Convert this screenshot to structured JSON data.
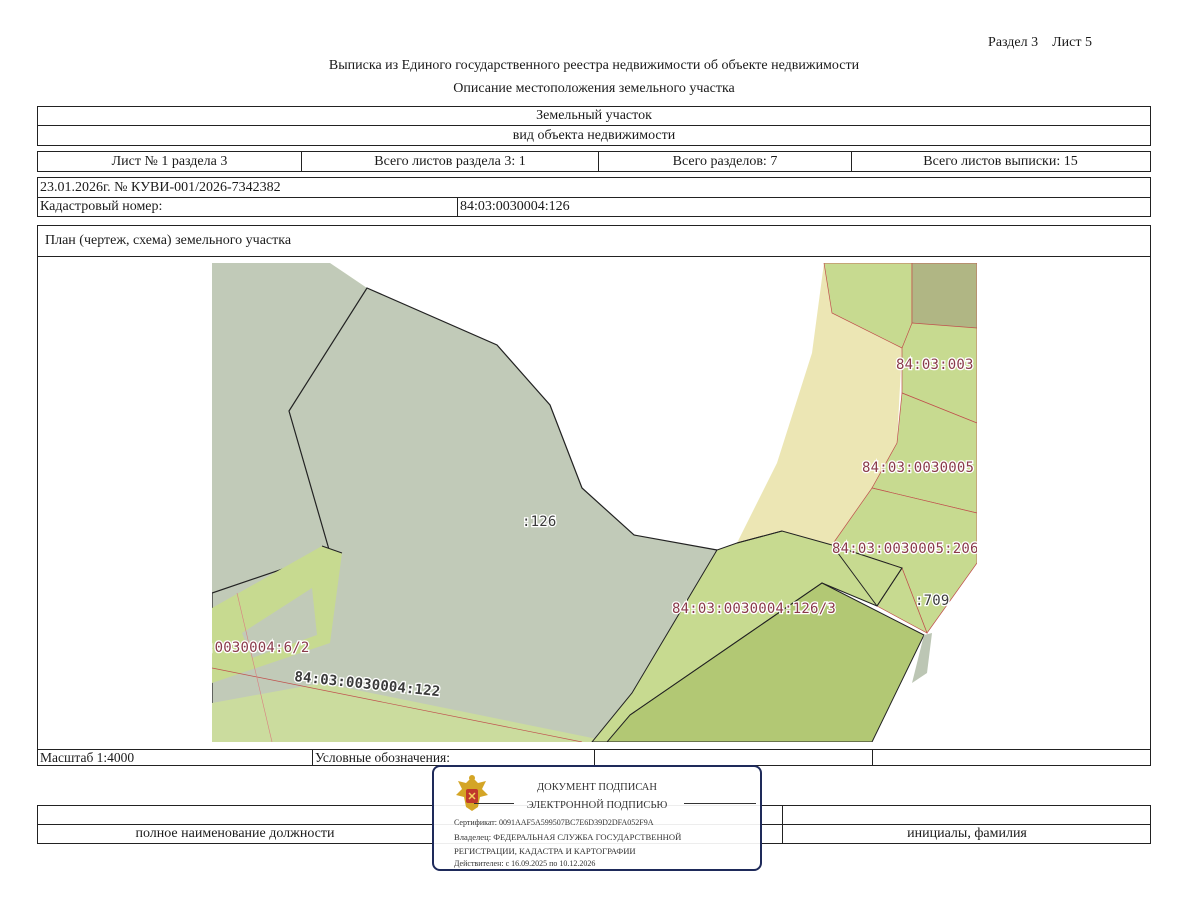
{
  "header": {
    "section_page": "Раздел 3    Лист 5",
    "title": "Выписка из Единого государственного реестра недвижимости об объекте недвижимости",
    "subtitle": "Описание местоположения земельного участка"
  },
  "object": {
    "type": "Земельный участок",
    "type_caption": "вид объекта недвижимости"
  },
  "sheet_info": {
    "sheet": "Лист № 1 раздела 3",
    "sheets_in_section": "Всего листов раздела 3: 1",
    "total_sections": "Всего разделов: 7",
    "total_sheets": "Всего листов выписки: 15"
  },
  "record": {
    "date_number": "23.01.2026г. № КУВИ-001/2026-7342382",
    "cadastral_label": "Кадастровый номер:",
    "cadastral_value": "84:03:0030004:126"
  },
  "plan": {
    "title": "План (чертеж, схема) земельного участка",
    "labels": {
      "main_parcel": ":126",
      "parcel_126_3": "84:03:0030004:126/3",
      "parcel_122": "84:03:0030004:122",
      "parcel_6_2": ":0030004:6/2",
      "parcel_709": ":709",
      "parcel_206": "84:03:0030005:206",
      "parcel_0030005": "84:03:0030005",
      "parcel_003": "84:03:003"
    }
  },
  "footer": {
    "scale": "Масштаб 1:4000",
    "legend": "Условные обозначения:",
    "position_caption": "полное наименование должности",
    "name_caption": "инициалы, фамилия"
  },
  "signature_stamp": {
    "line1": "ДОКУМЕНТ ПОДПИСАН",
    "line2": "ЭЛЕКТРОННОЙ ПОДПИСЬЮ",
    "certificate": "Сертификат: 0091AAF5A599507BC7E6D39D2DFA052F9A",
    "owner_line1": "Владелец: ФЕДЕРАЛЬНАЯ СЛУЖБА ГОСУДАРСТВЕННОЙ",
    "owner_line2": "РЕГИСТРАЦИИ, КАДАСТРА И КАРТОГРАФИИ",
    "validity": "Действителен: с 16.09.2025 по 10.12.2026"
  },
  "colors": {
    "main_parcel": "#c1cab8",
    "light_green": "#c7da90",
    "green": "#b8cf7c",
    "dark_green": "#b2c874",
    "olive": "#b0b684",
    "sand": "#ece6b4",
    "boundary_red": "#c0504d",
    "stamp_border": "#1e2a5a"
  }
}
